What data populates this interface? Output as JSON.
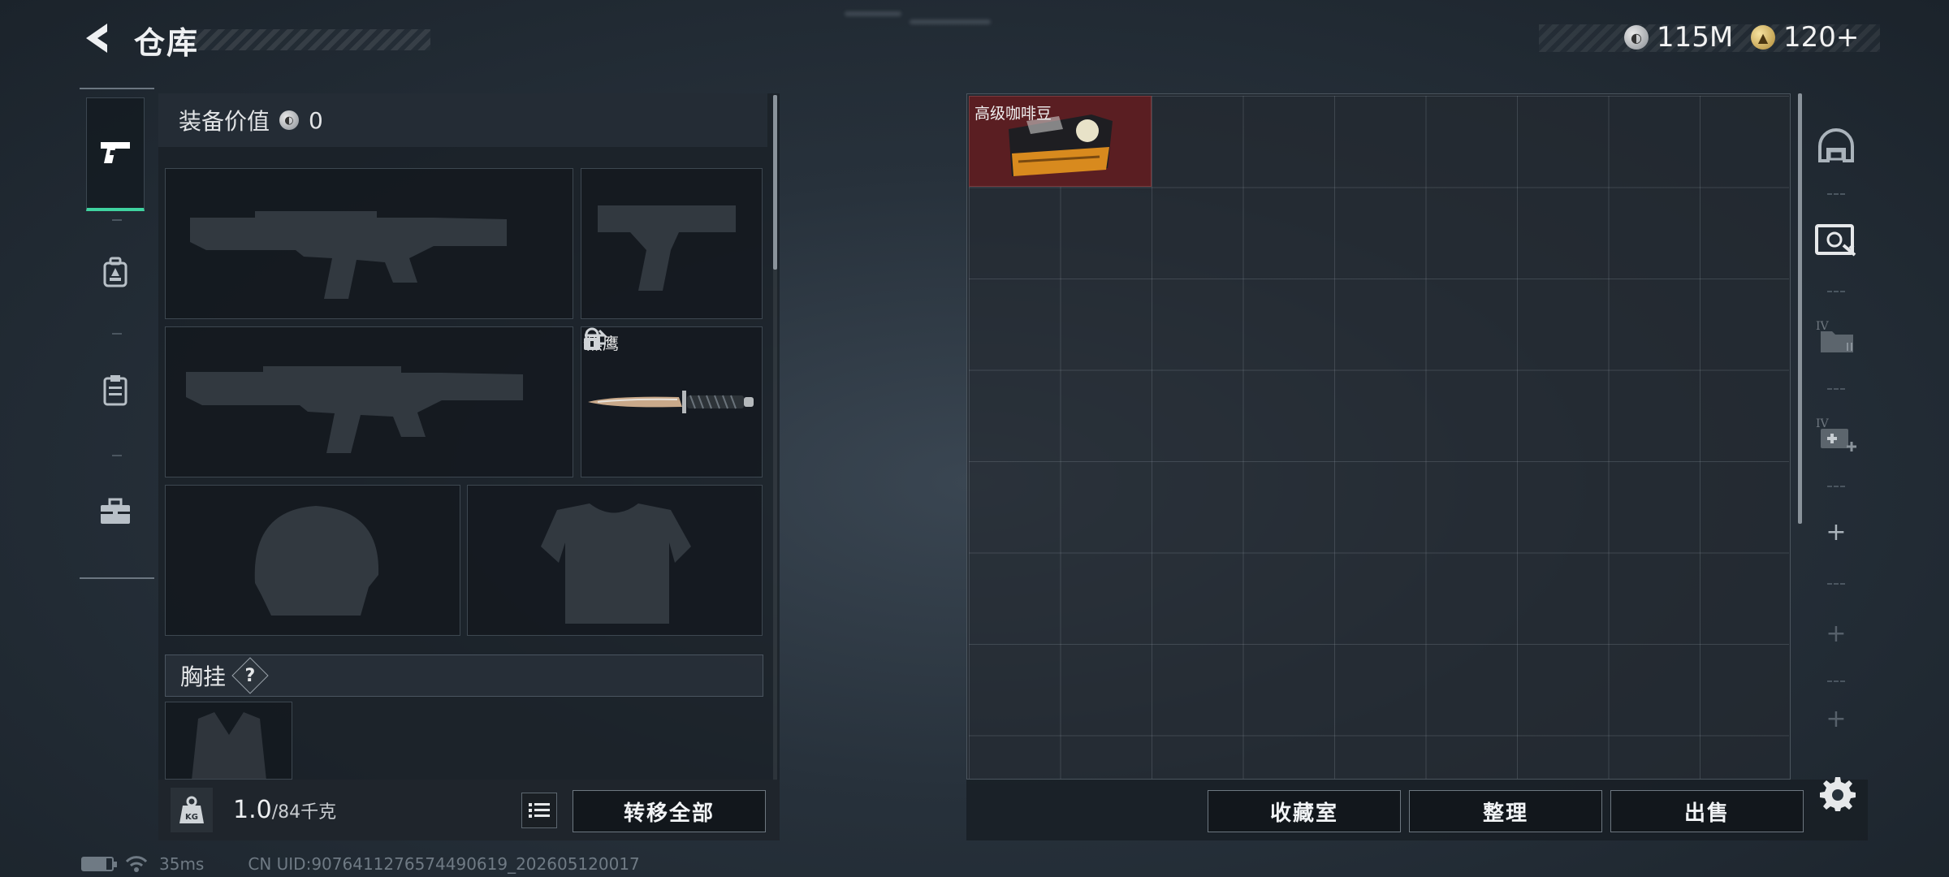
{
  "header": {
    "title": "仓库",
    "currency_silver": "115M",
    "currency_gold": "120+"
  },
  "categories": [
    {
      "icon": "pistol-icon",
      "active": true
    },
    {
      "icon": "backpack-icon",
      "active": false
    },
    {
      "icon": "clipboard-icon",
      "active": false
    },
    {
      "icon": "toolbox-icon",
      "active": false
    }
  ],
  "equipment": {
    "value_label": "装备价值",
    "value": "0",
    "melee_slot_label": "黑鹰",
    "chest_rig_label": "胸挂",
    "chest_rig_help": "?"
  },
  "weight": {
    "current": "1.0",
    "max": "/84千克",
    "icon_text": "KG"
  },
  "buttons": {
    "transfer_all": "转移全部",
    "collection_room": "收藏室",
    "organize": "整理",
    "sell": "出售"
  },
  "storage": {
    "items": [
      {
        "name": "高级咖啡豆",
        "rarity_color": "#5a1e22"
      }
    ]
  },
  "right_rail": [
    {
      "icon": "helmet-icon"
    },
    {
      "icon": "safe-box-icon"
    },
    {
      "icon": "folder-lv4-icon"
    },
    {
      "icon": "medkit-lv4-icon"
    },
    {
      "icon": "plus-icon"
    },
    {
      "icon": "plus-icon"
    },
    {
      "icon": "plus-icon"
    }
  ],
  "footer": {
    "ping": "35ms",
    "uid": "CN UID:9076411276574490619_202605120017"
  },
  "colors": {
    "accent": "#3fd3a0",
    "rarity_red": "#5a1e22"
  }
}
